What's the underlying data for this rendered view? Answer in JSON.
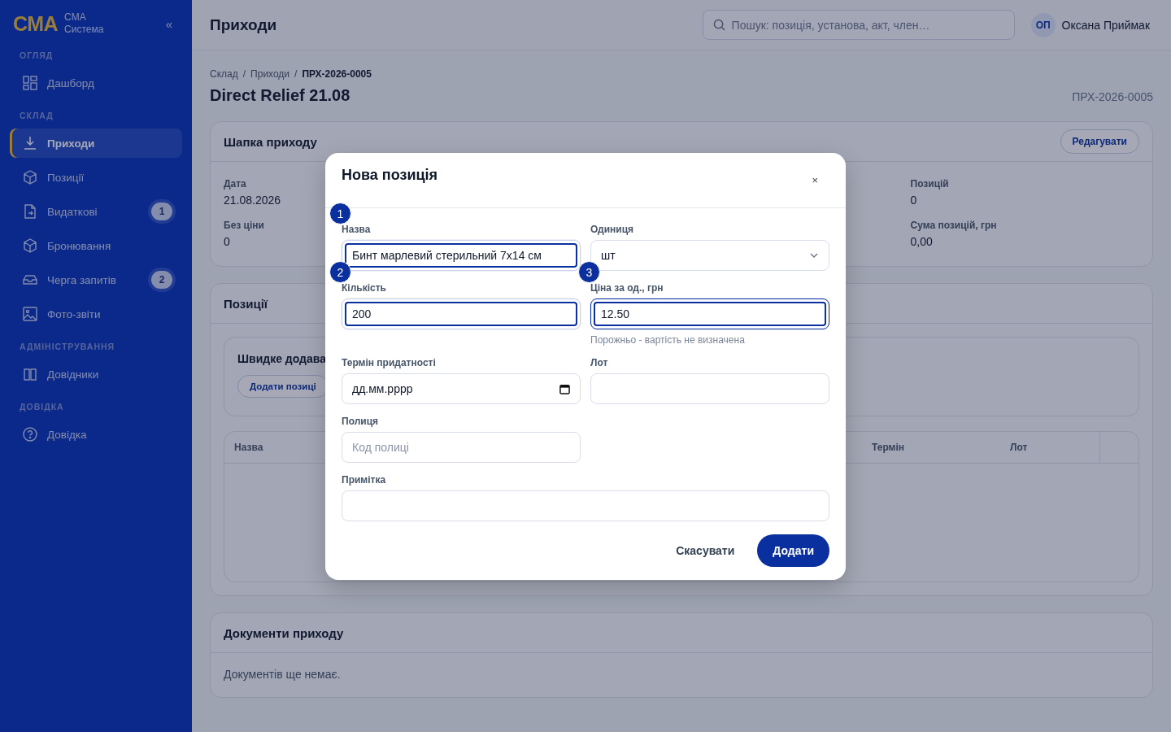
{
  "sidebar": {
    "logo": "СМА",
    "brand_line_1": "СМА",
    "brand_line_2": "Система",
    "collapse": "«",
    "sections": [
      {
        "title": "ОГЛЯД",
        "items": [
          {
            "label": "Дашборд",
            "selected": false
          }
        ]
      },
      {
        "title": "СКЛАД",
        "items": [
          {
            "label": "Приходи",
            "selected": true
          },
          {
            "label": "Позиції",
            "selected": false
          },
          {
            "label": "Видаткові",
            "selected": false,
            "badge": "1"
          },
          {
            "label": "Бронювання",
            "selected": false
          },
          {
            "label": "Черга запитів",
            "selected": false,
            "badge": "2"
          },
          {
            "label": "Фото-звіти",
            "selected": false
          }
        ]
      },
      {
        "title": "АДМІНІСТРУВАННЯ",
        "items": [
          {
            "label": "Довідники",
            "selected": false
          }
        ]
      },
      {
        "title": "ДОВІДКА",
        "items": [
          {
            "label": "Довідка",
            "selected": false
          }
        ]
      }
    ]
  },
  "topbar": {
    "title": "Приходи",
    "search": {
      "placeholder": "Пошук: позиція, установа, акт, член…"
    },
    "user": {
      "initials": "ОП",
      "name": "Оксана Приймак"
    }
  },
  "breadcrumb": [
    {
      "label": "Склад",
      "current": false
    },
    {
      "separator": "/",
      "label": "Приходи",
      "current": false
    },
    {
      "separator": "/",
      "label": "ПРХ-2026-0005",
      "current": true
    }
  ],
  "page_title": "Direct Relief 21.08",
  "doc_number": "ПРХ-2026-0005",
  "header_card": {
    "title": "Шапка приходу",
    "edit_button": "Редагувати",
    "fields": [
      {
        "label": "Дата",
        "value": "21.08.2026"
      },
      {
        "label": "Без ціни",
        "value": "0"
      },
      {
        "label": "Позицій",
        "value": "0"
      },
      {
        "label": "Сума позицій, грн",
        "value": "0,00"
      }
    ]
  },
  "positions_card": {
    "title": "Позиції",
    "quick_add": {
      "title": "Швидке додава",
      "button": "Додати позиці"
    },
    "table": {
      "columns": [
        "Назва",
        "Термін",
        "Лот"
      ]
    }
  },
  "documents_card": {
    "title": "Документи приходу",
    "empty_text": "Документів ще немає."
  },
  "modal": {
    "title": "Нова позиція",
    "close": "×",
    "fields": [
      {
        "kind": "text",
        "label": "Назва",
        "value": "Бинт марлевий стерильний 7x14 см",
        "step": "1",
        "focused": true,
        "active": false
      },
      {
        "kind": "select",
        "label": "Одиниця",
        "value": "шт",
        "focused": false,
        "active": false
      },
      {
        "kind": "text",
        "label": "Кількість",
        "value": "200",
        "step": "2",
        "focused": true,
        "active": false
      },
      {
        "kind": "text",
        "label": "Ціна за од., грн",
        "value": "12.50",
        "step": "3",
        "focused": true,
        "active": true,
        "hint": "Порожньо - вартість не визначена"
      },
      {
        "kind": "date",
        "label": "Термін придатності",
        "placeholder": "дд.мм.рррр",
        "focused": false,
        "active": false
      },
      {
        "kind": "text",
        "label": "Лот",
        "focused": false,
        "active": false
      },
      {
        "kind": "text",
        "label": "Полиця",
        "placeholder": "Код полиці",
        "focused": false,
        "active": false
      },
      {
        "kind": "wide_text",
        "label": "Примітка",
        "focused": false,
        "active": false
      }
    ],
    "cancel_button": "Скасувати",
    "submit_button": "Додати"
  }
}
